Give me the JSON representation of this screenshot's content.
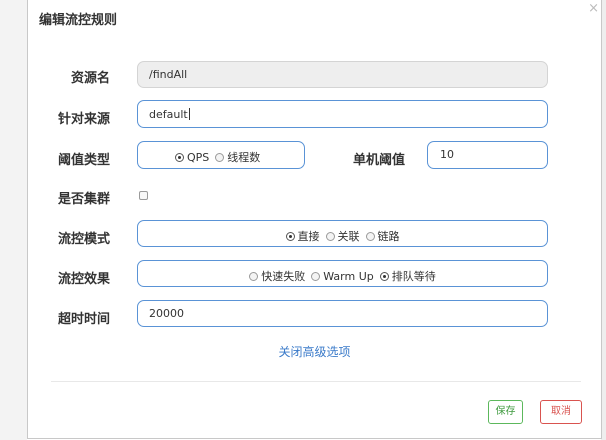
{
  "dialog": {
    "title": "编辑流控规则",
    "close_glyph": "×"
  },
  "form": {
    "resource": {
      "label": "资源名",
      "value": "/findAll"
    },
    "limit_app": {
      "label": "针对来源",
      "value": "default"
    },
    "threshold_type": {
      "label": "阈值类型",
      "options": [
        {
          "label": "QPS",
          "checked": true
        },
        {
          "label": "线程数",
          "checked": false
        }
      ]
    },
    "single_threshold": {
      "label": "单机阈值",
      "value": "10"
    },
    "cluster": {
      "label": "是否集群",
      "checked": false
    },
    "strategy": {
      "label": "流控模式",
      "options": [
        {
          "label": "直接",
          "checked": true
        },
        {
          "label": "关联",
          "checked": false
        },
        {
          "label": "链路",
          "checked": false
        }
      ]
    },
    "effect": {
      "label": "流控效果",
      "options": [
        {
          "label": "快速失败",
          "checked": false
        },
        {
          "label": "Warm Up",
          "checked": false
        },
        {
          "label": "排队等待",
          "checked": true
        }
      ]
    },
    "timeout": {
      "label": "超时时间",
      "value": "20000"
    }
  },
  "advanced_link": "关闭高级选项",
  "footer": {
    "save_label": "保存",
    "cancel_label": "取消"
  }
}
